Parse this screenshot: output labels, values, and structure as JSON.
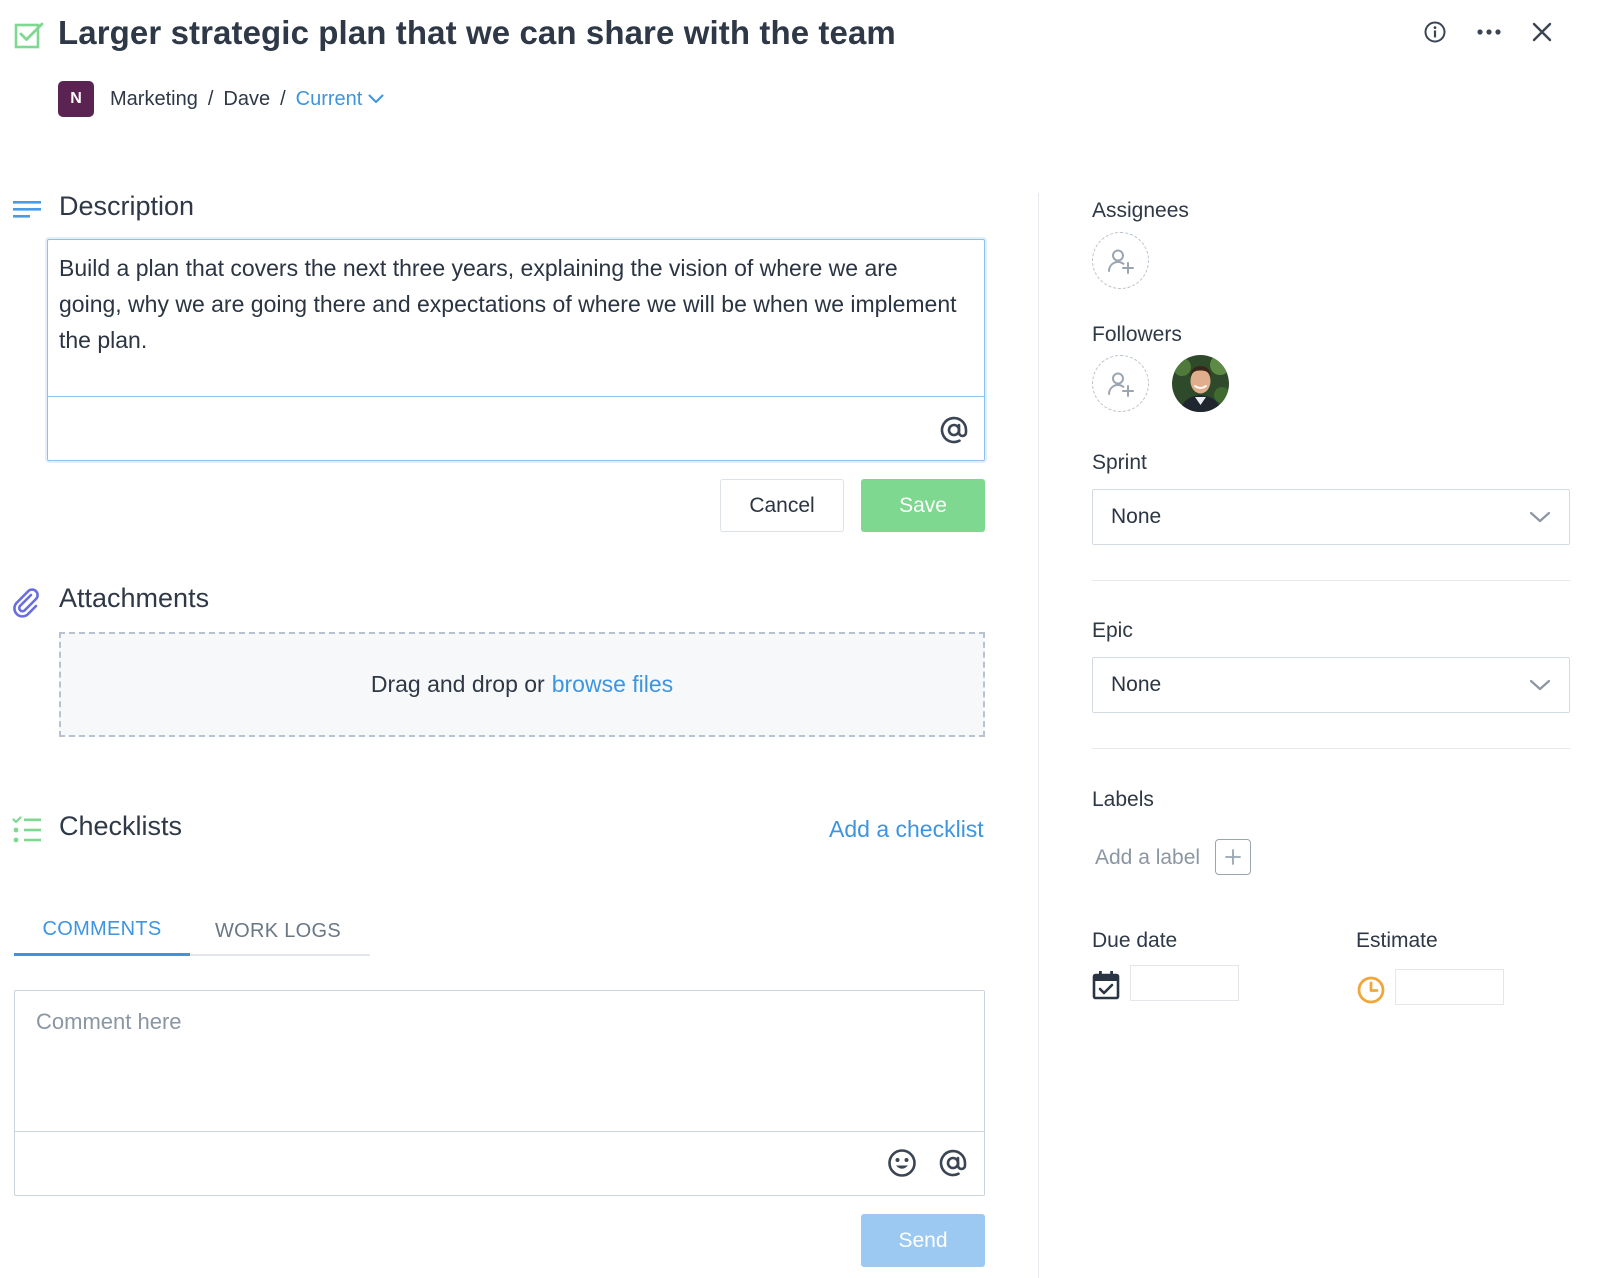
{
  "task": {
    "title": "Larger strategic plan that we can share with the team"
  },
  "breadcrumb": {
    "badge": "N",
    "project": "Marketing",
    "sep1": "/",
    "owner": "Dave",
    "sep2": "/",
    "current": "Current"
  },
  "description": {
    "heading": "Description",
    "text": "Build a plan that covers the next three years, explaining the vision of where we are going, why we are going there and expectations of where we will be when we implement the plan.",
    "cancel_label": "Cancel",
    "save_label": "Save"
  },
  "attachments": {
    "heading": "Attachments",
    "drop_text": "Drag and drop or",
    "browse_text": "browse files"
  },
  "checklists": {
    "heading": "Checklists",
    "add_label": "Add a checklist"
  },
  "tabs": [
    {
      "label": "COMMENTS",
      "active": true
    },
    {
      "label": "WORK LOGS",
      "active": false
    }
  ],
  "comment": {
    "placeholder": "Comment here",
    "send_label": "Send"
  },
  "sidebar": {
    "assignees_label": "Assignees",
    "followers_label": "Followers",
    "sprint_label": "Sprint",
    "sprint_value": "None",
    "epic_label": "Epic",
    "epic_value": "None",
    "labels_label": "Labels",
    "add_label_text": "Add a label",
    "due_date_label": "Due date",
    "estimate_label": "Estimate"
  },
  "colors": {
    "accent_blue": "#3d95e0",
    "save_green": "#7ed88f",
    "send_blue": "#9cc9f2",
    "project_badge": "#5b2352",
    "estimate_orange": "#f0a73a"
  }
}
